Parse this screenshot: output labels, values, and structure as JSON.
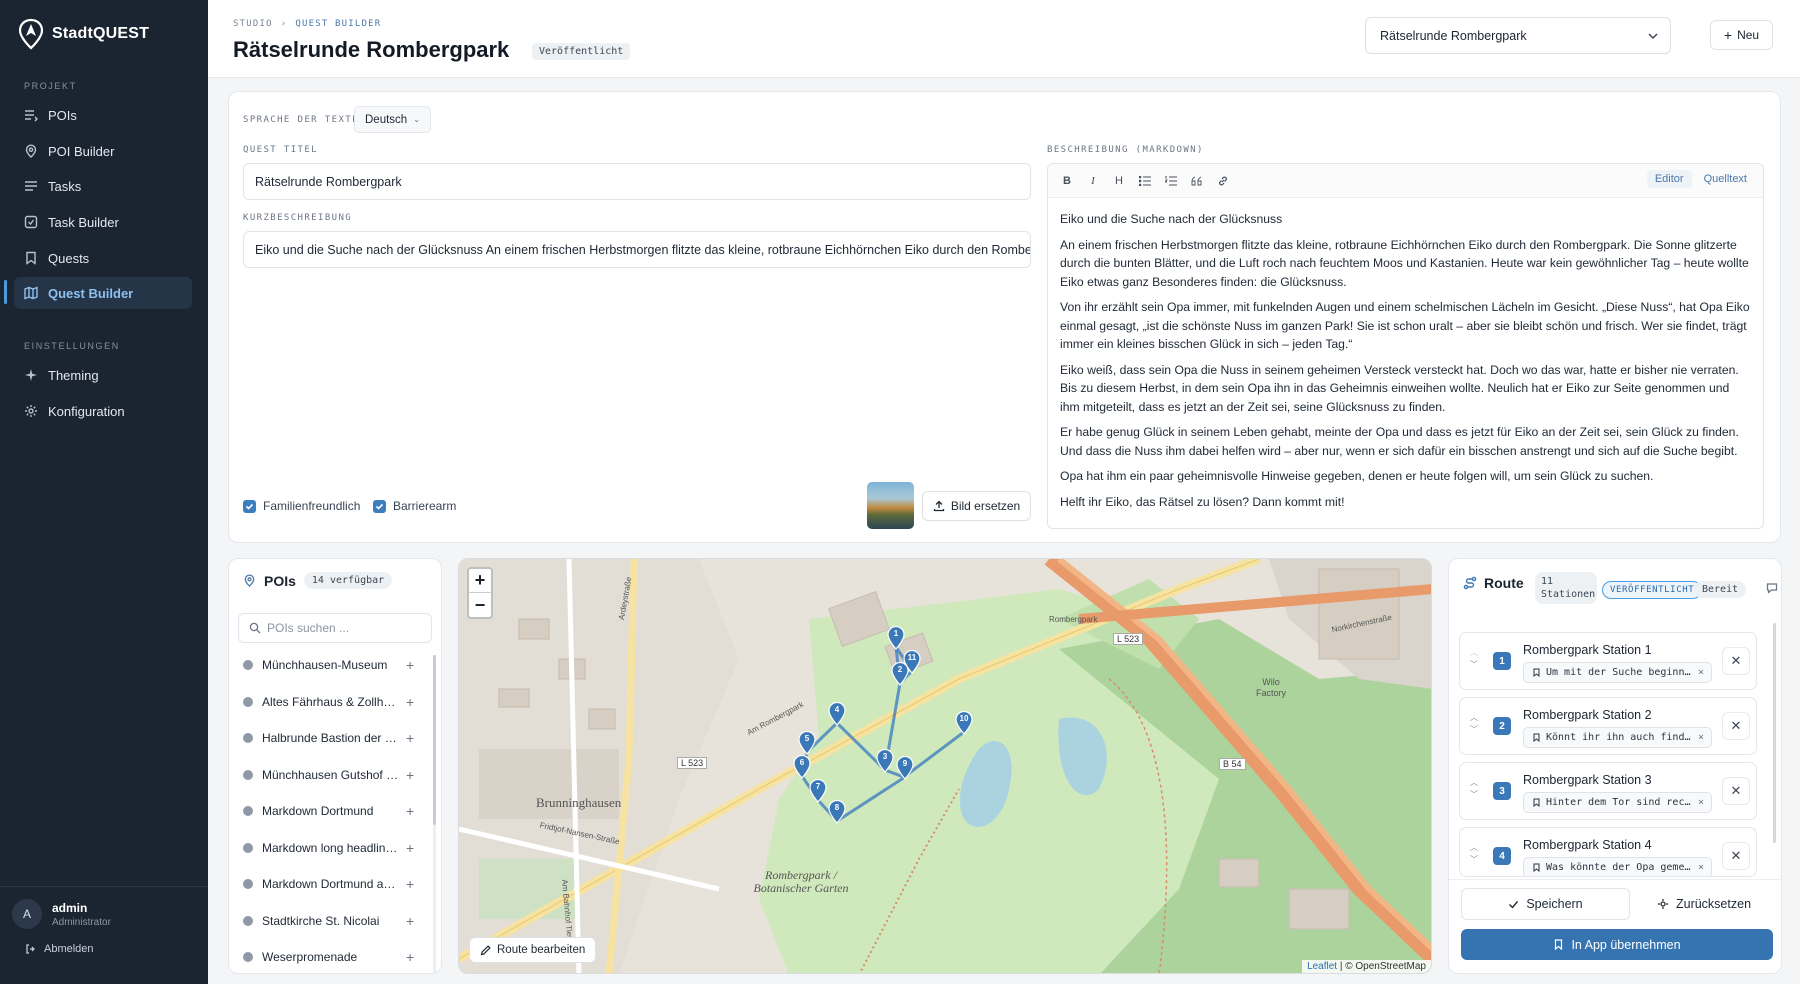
{
  "app": {
    "brand": "StadtQUEST"
  },
  "sidebar": {
    "section_project": "PROJEKT",
    "items": [
      {
        "label": "POIs",
        "icon": "list-icon"
      },
      {
        "label": "POI Builder",
        "icon": "map-pin-icon"
      },
      {
        "label": "Tasks",
        "icon": "lines-icon"
      },
      {
        "label": "Task Builder",
        "icon": "checkbox-icon"
      },
      {
        "label": "Quests",
        "icon": "bookmark-icon"
      },
      {
        "label": "Quest Builder",
        "icon": "map-icon",
        "active": true
      }
    ],
    "section_settings": "EINSTELLUNGEN",
    "settings_items": [
      {
        "label": "Theming",
        "icon": "sparkle-icon"
      },
      {
        "label": "Konfiguration",
        "icon": "gear-icon"
      }
    ],
    "user": {
      "avatar": "A",
      "name": "admin",
      "role": "Administrator"
    },
    "logout": "Abmelden"
  },
  "header": {
    "breadcrumb": [
      "STUDIO",
      "QUEST BUILDER"
    ],
    "breadcrumb_sep": "›",
    "title": "Rätselrunde Rombergpark",
    "status": "Veröffentlicht",
    "quest_select": "Rätselrunde Rombergpark",
    "new_label": "Neu"
  },
  "form": {
    "lang_label": "SPRACHE DER TEXTE",
    "lang_value": "Deutsch",
    "title_label": "QUEST TITEL",
    "title_value": "Rätselrunde Rombergpark",
    "short_label": "KURZBESCHREIBUNG",
    "short_value": "Eiko und die Suche nach der Glücksnuss An einem frischen Herbstmorgen flitzte das kleine, rotbraune Eichhörnchen Eiko durch den Rombergpark.",
    "family": "Familienfreundlich",
    "barrier": "Barrierearm",
    "replace_image": "Bild ersetzen",
    "desc_label": "BESCHREIBUNG (MARKDOWN)",
    "toolbar": [
      "B",
      "I",
      "H"
    ],
    "mode_editor": "Editor",
    "mode_source": "Quelltext",
    "desc_paragraphs": [
      "Eiko und die Suche nach der Glücksnuss",
      "An einem frischen Herbstmorgen flitzte das kleine, rotbraune Eichhörnchen Eiko durch den Rombergpark. Die Sonne glitzerte durch die bunten Blätter, und die Luft roch nach feuchtem Moos und Kastanien. Heute war kein gewöhnlicher Tag – heute wollte Eiko etwas ganz Besonderes finden: die Glücksnuss.",
      "Von ihr erzählt sein Opa immer, mit funkelnden Augen und einem schelmischen Lächeln im Gesicht. „Diese Nuss“, hat Opa Eiko einmal gesagt, „ist die schönste Nuss im ganzen Park! Sie ist schon uralt – aber sie bleibt schön und frisch. Wer sie findet, trägt immer ein kleines bisschen Glück in sich – jeden Tag.“",
      "Eiko weiß, dass sein Opa die Nuss in seinem geheimen Versteck versteckt hat. Doch wo das war, hatte er bisher nie verraten. Bis zu diesem Herbst, in dem sein Opa ihn in das Geheimnis einweihen wollte. Neulich hat er Eiko zur Seite genommen und ihm mitgeteilt, dass es jetzt an der Zeit sei, seine Glücksnuss zu finden.",
      "Er habe genug Glück in seinem Leben gehabt, meinte der Opa und dass es jetzt für Eiko an der Zeit sei, sein Glück zu finden. Und dass die Nuss ihm dabei helfen wird – aber nur, wenn er sich dafür ein bisschen anstrengt und sich auf die Suche begibt.",
      "Opa hat ihm ein paar geheimnisvolle Hinweise gegeben, denen er heute folgen will, um sein Glück zu suchen.",
      "Helft ihr Eiko, das Rätsel zu lösen? Dann kommt mit!"
    ]
  },
  "pois": {
    "title": "POIs",
    "count": "14 verfügbar",
    "search_placeholder": "POIs suchen ...",
    "items": [
      "Münchhausen-Museum",
      "Altes Fährhaus & Zollhaus",
      "Halbrunde Bastion der Stadtmauer",
      "Münchhausen Gutshof / Herrenhaus",
      "Markdown Dortmund",
      "Markdown long headline example",
      "Markdown Dortmund ausführlich",
      "Stadtkirche St. Nicolai",
      "Weserpromenade"
    ]
  },
  "map": {
    "zoom_in": "+",
    "zoom_out": "−",
    "route_edit": "Route bearbeiten",
    "attribution_leaflet": "Leaflet",
    "attribution_osm": "| © OpenStreetMap",
    "labels": [
      "Brunninghausen",
      "Rombergpark / Botanischer Garten",
      "L 523",
      "L 523",
      "B 54",
      "Wilo Factory",
      "Ardeystraße",
      "Am Rombergpark",
      "Rombergpark",
      "Fridtjof-Nansen-Straße",
      "Am Bahnhof Tierpark",
      "Norkirchenstraße"
    ],
    "markers": [
      "1",
      "2",
      "3",
      "4",
      "5",
      "6",
      "7",
      "8",
      "9",
      "10",
      "11"
    ]
  },
  "route": {
    "title": "Route",
    "count": "11 Stationen",
    "status": "VERÖFFENTLICHT",
    "ready": "Bereit",
    "stations": [
      {
        "num": "1",
        "name": "Rombergpark Station 1",
        "task": "Um mit der Suche beginnen zu können"
      },
      {
        "num": "2",
        "name": "Rombergpark Station 2",
        "task": "Könnt ihr ihn auch finden?"
      },
      {
        "num": "3",
        "name": "Rombergpark Station 3",
        "task": "Hinter dem Tor sind recht viele"
      },
      {
        "num": "4",
        "name": "Rombergpark Station 4",
        "task": "Was könnte der Opa gemeint haben?"
      }
    ],
    "save": "Speichern",
    "reset": "Zurücksetzen",
    "apply": "In App übernehmen"
  },
  "colors": {
    "accent": "#3574b0",
    "sidebar": "#1b2431",
    "active_nav": "#8cc1f0"
  }
}
